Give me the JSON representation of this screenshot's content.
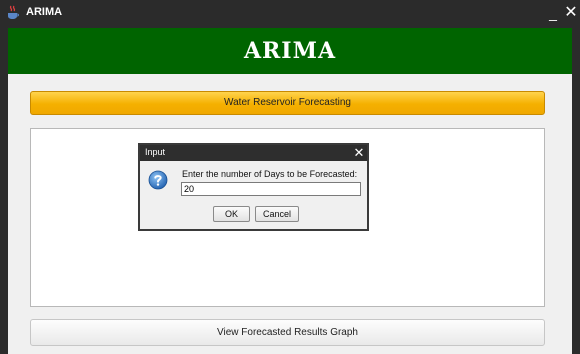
{
  "window": {
    "title": "ARIMA",
    "minimize_glyph": "_",
    "close_glyph": "✕",
    "app_icon": "java-cup-icon"
  },
  "header": {
    "heading": "ARIMA",
    "background_color": "#006400"
  },
  "main": {
    "forecast_button_label": "Water Reservoir Forecasting",
    "graph_button_label": "View Forecasted Results Graph",
    "accent_color": "#f5b000"
  },
  "dialog": {
    "title": "Input",
    "close_glyph": "✕",
    "icon": "question-icon",
    "prompt": "Enter the number of Days to be Forecasted:",
    "input_value": "20",
    "ok_label": "OK",
    "cancel_label": "Cancel"
  }
}
